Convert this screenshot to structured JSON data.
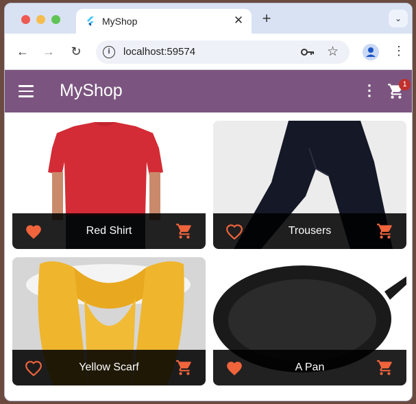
{
  "browser": {
    "tab_title": "MyShop",
    "tab_close": "✕",
    "new_tab": "+",
    "tab_menu": "⌄",
    "url": "localhost:59574",
    "info_symbol": "i",
    "back": "←",
    "forward": "→",
    "reload": "↻",
    "star": "☆",
    "menu": "⋮"
  },
  "app": {
    "title": "MyShop",
    "more": "⋮",
    "cart_count": "1",
    "accent": "#7b5580",
    "icon_color": "#f0643c"
  },
  "products": [
    {
      "name": "Red Shirt",
      "favorite": true
    },
    {
      "name": "Trousers",
      "favorite": false
    },
    {
      "name": "Yellow Scarf",
      "favorite": false
    },
    {
      "name": "A Pan",
      "favorite": true
    }
  ]
}
